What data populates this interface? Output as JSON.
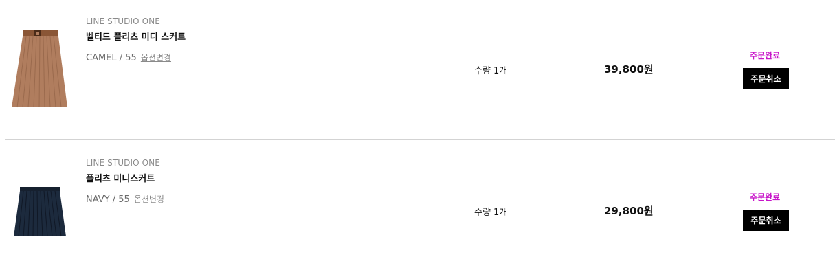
{
  "orders": [
    {
      "brand": "LINE STUDIO ONE",
      "name": "벨티드 플리츠 미디 스커트",
      "option": "CAMEL / 55",
      "option_change": "옵션변경",
      "quantity": "수량 1개",
      "price": "39,800원",
      "status": "주문완료",
      "cancel_label": "주문취소",
      "image": "camel-pleated-midi-skirt-with-belt"
    },
    {
      "brand": "LINE STUDIO ONE",
      "name": "플리츠 미니스커트",
      "option": "NAVY / 55",
      "option_change": "옵션변경",
      "quantity": "수량 1개",
      "price": "29,800원",
      "status": "주문완료",
      "cancel_label": "주문취소",
      "image": "navy-pleated-mini-skirt"
    }
  ],
  "colors": {
    "status": "#c814c9",
    "cancel_bg": "#000000",
    "divider": "#d3d3d3",
    "camel": "#b07d5e",
    "navy": "#1c2a3d"
  }
}
